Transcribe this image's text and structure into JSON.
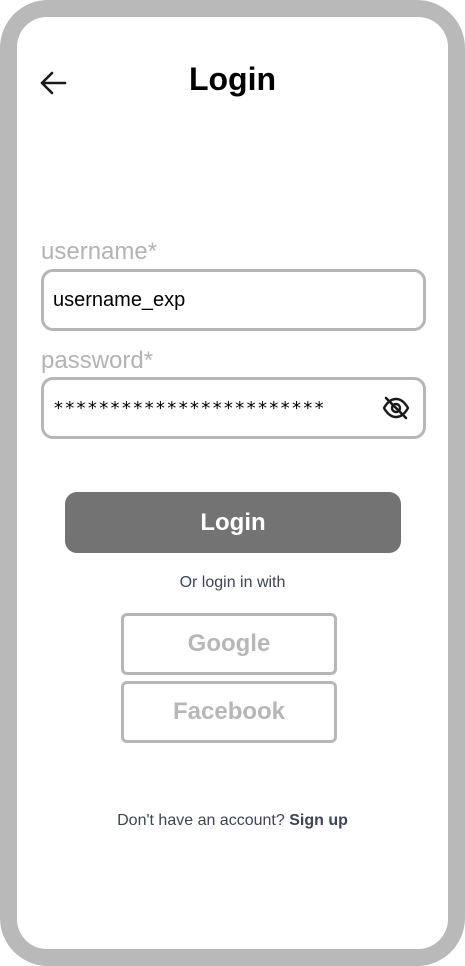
{
  "header": {
    "title": "Login",
    "back_icon": "arrow-left-icon"
  },
  "form": {
    "username_label": "username*",
    "username_value": "username_exp",
    "password_label": "password*",
    "password_value": "************************",
    "password_toggle_icon": "eye-off-icon"
  },
  "actions": {
    "login_label": "Login",
    "or_text": "Or login in with",
    "google_label": "Google",
    "facebook_label": "Facebook"
  },
  "footer": {
    "prompt": "Don't have an account?",
    "signup_label": "Sign up"
  },
  "colors": {
    "frame": "#b9b9b9",
    "primary_button": "#737373",
    "border": "#b6b6b6",
    "muted_text": "#b3b3b3",
    "body_text": "#3d4453"
  }
}
